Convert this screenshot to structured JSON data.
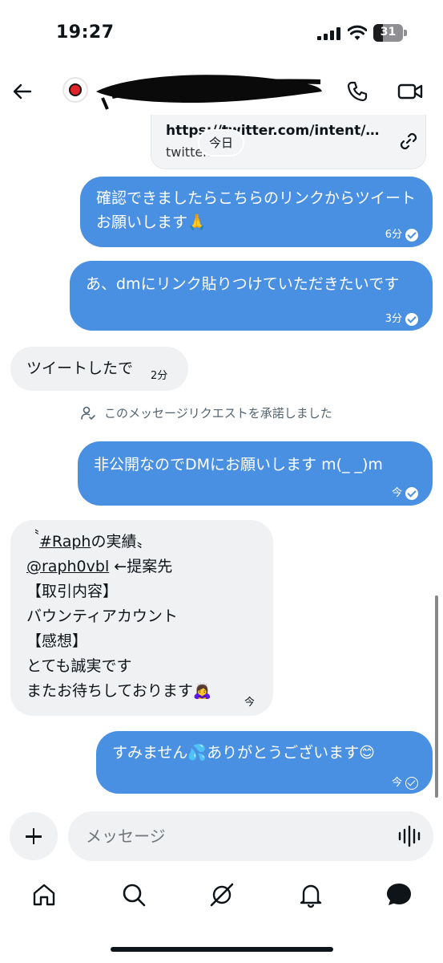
{
  "status_bar": {
    "time": "19:27",
    "battery": "31"
  },
  "header": {
    "back_icon": "arrow-left-icon",
    "call_icon": "phone-icon",
    "video_icon": "video-camera-icon"
  },
  "link_preview": {
    "url": "https://twitter.com/intent/tw...",
    "domain": "twitter.",
    "icon": "link-icon"
  },
  "date_separator": "今日",
  "messages": [
    {
      "direction": "out",
      "text": "確認できましたらこちらのリンクからツイートお願いします🙏",
      "time": "6分",
      "status": "read"
    },
    {
      "direction": "out",
      "text": "あ、dmにリンク貼りつけていただきたいです",
      "time": "3分",
      "status": "read"
    },
    {
      "direction": "in",
      "text": "ツイートしたで",
      "time": "2分"
    },
    {
      "direction": "out",
      "text": "非公開なのでDMにお願いします m(_ _)m",
      "time": "今",
      "status": "read"
    },
    {
      "direction": "in",
      "hashtag": "#Raph",
      "lines": [
        "〝#Raphの実績〟",
        "@raph0vbl ←提案先",
        "【取引内容】",
        "バウンティアカウント",
        "【感想】",
        "とても誠実です",
        "またお待ちしております🙇‍♀️"
      ],
      "mention": "@raph0vbl",
      "time": "今"
    },
    {
      "direction": "out",
      "text": "すみません💦ありがとうございます😊",
      "time": "今",
      "status": "sent"
    }
  ],
  "system_note": {
    "text": "このメッセージリクエストを承諾しました",
    "icon": "person-check-icon"
  },
  "composer": {
    "placeholder": "メッセージ",
    "plus_icon": "plus-icon",
    "voice_icon": "voice-waveform-icon"
  },
  "tabbar": {
    "items": [
      "home-icon",
      "search-icon",
      "grok-icon",
      "bell-icon",
      "messages-icon"
    ],
    "active": "messages-icon"
  },
  "colors": {
    "outgoing_bubble": "#4a90e2",
    "incoming_bubble": "#eff1f3",
    "text": "#0f1419",
    "muted": "#536471"
  }
}
